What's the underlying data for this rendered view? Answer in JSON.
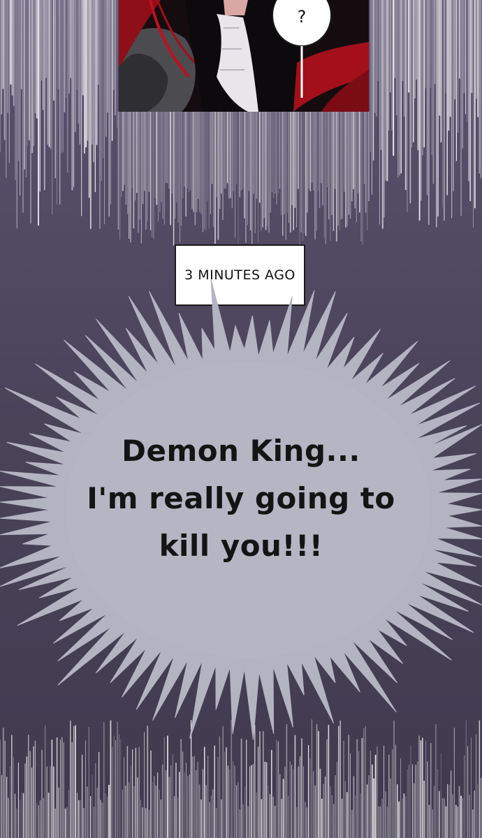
{
  "top_panel": {
    "speech_bubble": {
      "text": "?"
    }
  },
  "caption": {
    "text": "3 MINUTES AGO"
  },
  "shout": {
    "lines": [
      "Demon King...",
      "I'm really going to",
      "kill you!!!"
    ]
  },
  "colors": {
    "background": "#4a4459",
    "burst_fill": "#b3b3c2",
    "speed_lines": "#ffffff",
    "caption_box": "#ffffff"
  }
}
